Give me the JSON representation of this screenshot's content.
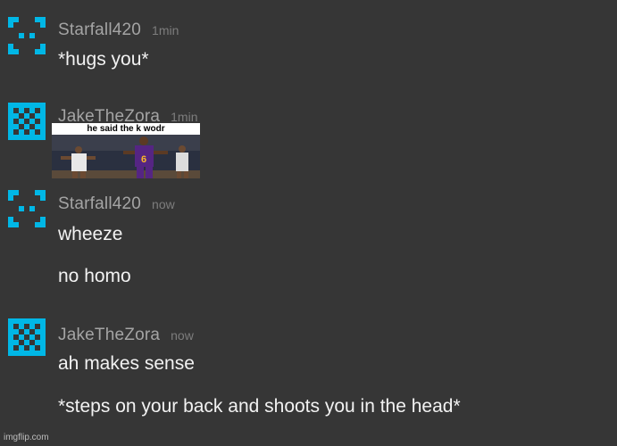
{
  "colors": {
    "background": "#363636",
    "avatar_accent": "#00b7e6",
    "username": "#a4a4a4",
    "timestamp": "#7d7d7d",
    "message_text": "#f2f2f2"
  },
  "messages": [
    {
      "avatar_icon": "x-pattern-avatar-icon",
      "username": "Starfall420",
      "time": "1min",
      "lines": [
        "*hugs you*"
      ]
    },
    {
      "avatar_icon": "checker-pattern-avatar-icon",
      "username": "JakeTheZora",
      "time": "1min",
      "image": {
        "caption": "he said the k wodr",
        "jersey_number": "6"
      }
    },
    {
      "avatar_icon": "x-pattern-avatar-icon",
      "username": "Starfall420",
      "time": "now",
      "lines": [
        "wheeze",
        "no homo"
      ]
    },
    {
      "avatar_icon": "checker-pattern-avatar-icon",
      "username": "JakeTheZora",
      "time": "now",
      "lines": [
        "ah makes sense",
        "*steps on your back and shoots you in the head*"
      ]
    }
  ],
  "watermark": "imgflip.com"
}
